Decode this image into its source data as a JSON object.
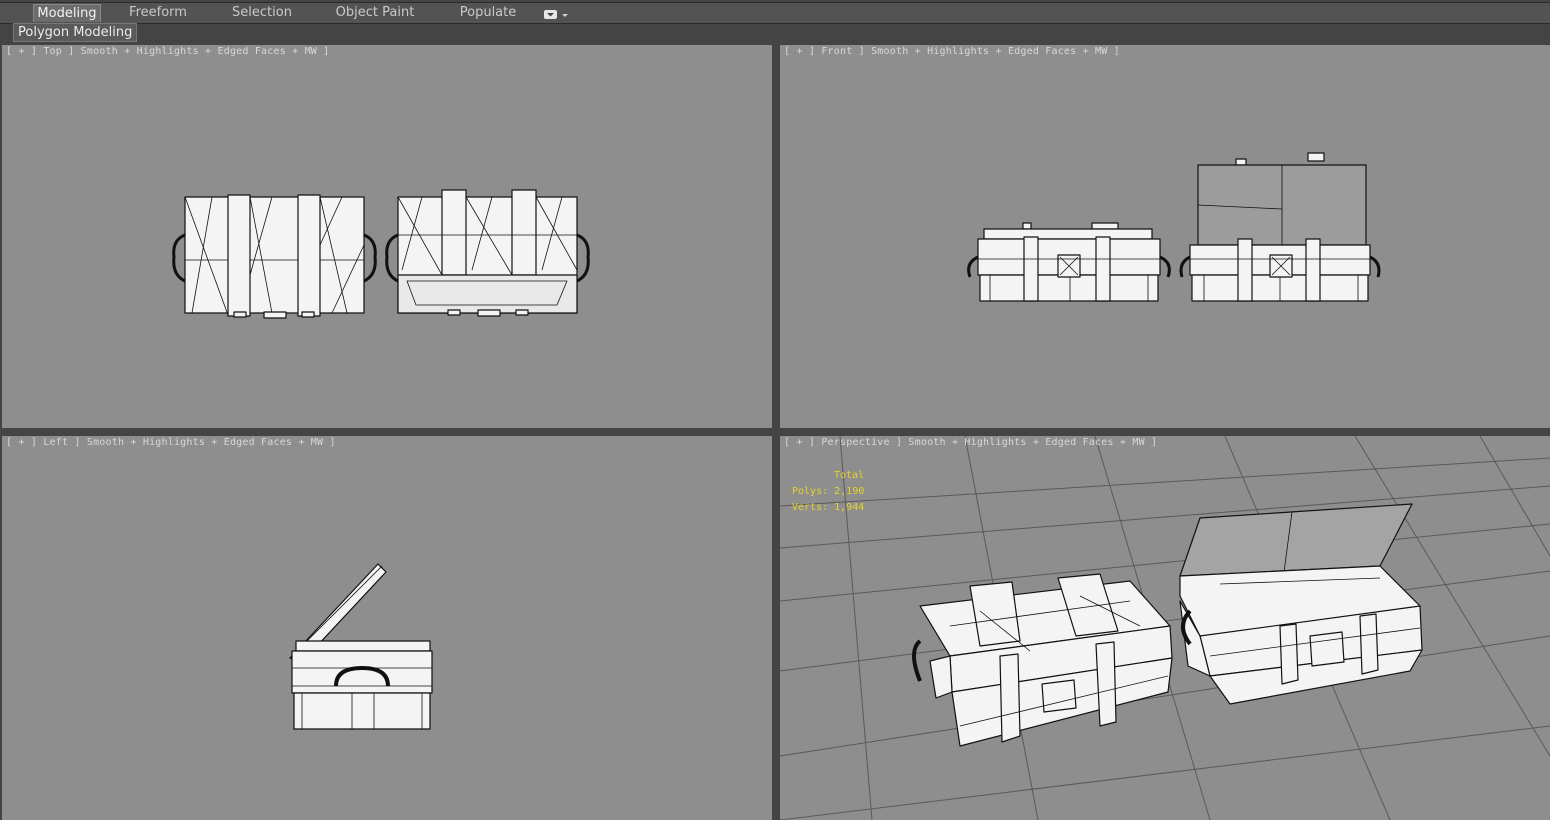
{
  "ribbon": {
    "tabs": [
      {
        "label": "Modeling",
        "active": true
      },
      {
        "label": "Freeform",
        "active": false
      },
      {
        "label": "Selection",
        "active": false
      },
      {
        "label": "Object Paint",
        "active": false
      },
      {
        "label": "Populate",
        "active": false
      }
    ],
    "group_label": "Polygon Modeling"
  },
  "viewports": {
    "top": {
      "label": "[ + ] Top ] Smooth + Highlights + Edged Faces + MW ]"
    },
    "front": {
      "label": "[ + ] Front ] Smooth + Highlights + Edged Faces + MW ]"
    },
    "left": {
      "label": "[ + ] Left ] Smooth + Highlights + Edged Faces + MW ]"
    },
    "perspective": {
      "label": "[ + ] Perspective ] Smooth + Highlights + Edged Faces + MW ]"
    }
  },
  "stats": {
    "title": "Total",
    "polys": "Polys: 2,190",
    "verts": "Verts: 1,944"
  },
  "colors": {
    "viewport_bg": "#8e8e8e",
    "stats_text": "#e8d428",
    "model_fill": "#f4f4f4",
    "wire": "#111111"
  }
}
